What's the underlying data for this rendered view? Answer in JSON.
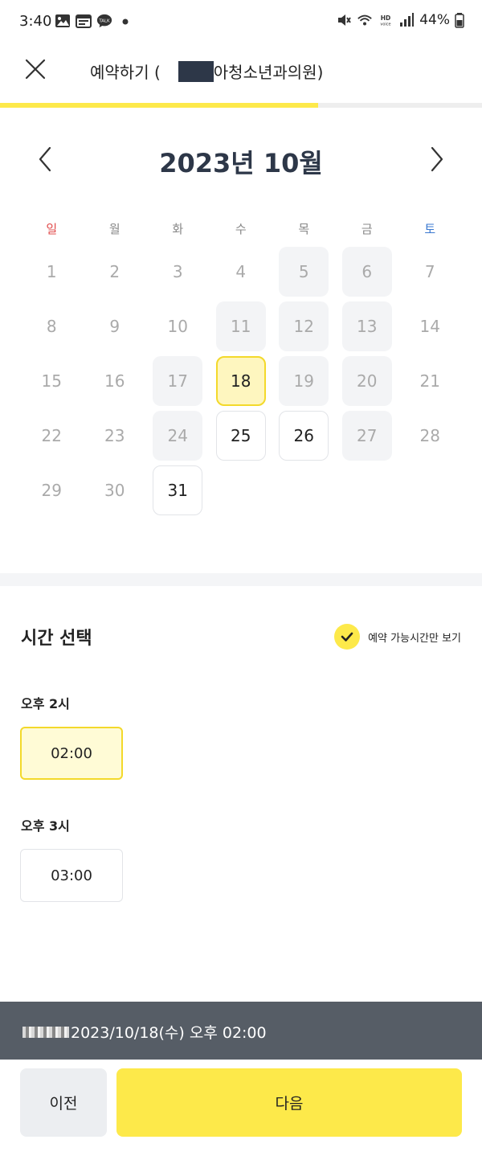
{
  "status_bar": {
    "time": "3:40",
    "battery": "44%",
    "left_icons": [
      "image-icon",
      "calendar-icon",
      "talk-icon",
      "dot-icon"
    ],
    "right_icons": [
      "mute-icon",
      "wifi-icon",
      "hd-voice-icon",
      "signal-icon",
      "battery-icon"
    ]
  },
  "header": {
    "title_prefix": "예약하기 (",
    "title_suffix": "아청소년과의원)",
    "progress": 0.66
  },
  "calendar": {
    "month_title": "2023년 10월",
    "weekdays": [
      "일",
      "월",
      "화",
      "수",
      "목",
      "금",
      "토"
    ],
    "start_offset": 0,
    "days": [
      {
        "d": "1",
        "s": "plain"
      },
      {
        "d": "2",
        "s": "plain"
      },
      {
        "d": "3",
        "s": "plain"
      },
      {
        "d": "4",
        "s": "plain"
      },
      {
        "d": "5",
        "s": "shaded"
      },
      {
        "d": "6",
        "s": "shaded"
      },
      {
        "d": "7",
        "s": "plain"
      },
      {
        "d": "8",
        "s": "plain"
      },
      {
        "d": "9",
        "s": "plain"
      },
      {
        "d": "10",
        "s": "plain"
      },
      {
        "d": "11",
        "s": "shaded"
      },
      {
        "d": "12",
        "s": "shaded"
      },
      {
        "d": "13",
        "s": "shaded"
      },
      {
        "d": "14",
        "s": "plain"
      },
      {
        "d": "15",
        "s": "plain"
      },
      {
        "d": "16",
        "s": "plain"
      },
      {
        "d": "17",
        "s": "shaded"
      },
      {
        "d": "18",
        "s": "selected"
      },
      {
        "d": "19",
        "s": "shaded"
      },
      {
        "d": "20",
        "s": "shaded"
      },
      {
        "d": "21",
        "s": "plain"
      },
      {
        "d": "22",
        "s": "plain"
      },
      {
        "d": "23",
        "s": "plain"
      },
      {
        "d": "24",
        "s": "shaded"
      },
      {
        "d": "25",
        "s": "avail"
      },
      {
        "d": "26",
        "s": "avail"
      },
      {
        "d": "27",
        "s": "shaded"
      },
      {
        "d": "28",
        "s": "plain"
      },
      {
        "d": "29",
        "s": "plain"
      },
      {
        "d": "30",
        "s": "plain"
      },
      {
        "d": "31",
        "s": "avail"
      }
    ]
  },
  "time_section": {
    "title": "시간 선택",
    "toggle_label": "예약 가능시간만 보기",
    "toggle_checked": true,
    "groups": [
      {
        "label": "오후 2시",
        "slots": [
          {
            "time": "02:00",
            "selected": true
          }
        ]
      },
      {
        "label": "오후 3시",
        "slots": [
          {
            "time": "03:00",
            "selected": false
          }
        ]
      }
    ]
  },
  "summary": {
    "text": "2023/10/18(수) 오후 02:00"
  },
  "buttons": {
    "prev": "이전",
    "next": "다음"
  },
  "colors": {
    "accent": "#fde94a",
    "accent_border": "#f3d92b",
    "selected_bg": "#fef6bf",
    "summary_bg": "#565d66",
    "sunday": "#e14b4b",
    "saturday": "#3a78d0"
  }
}
